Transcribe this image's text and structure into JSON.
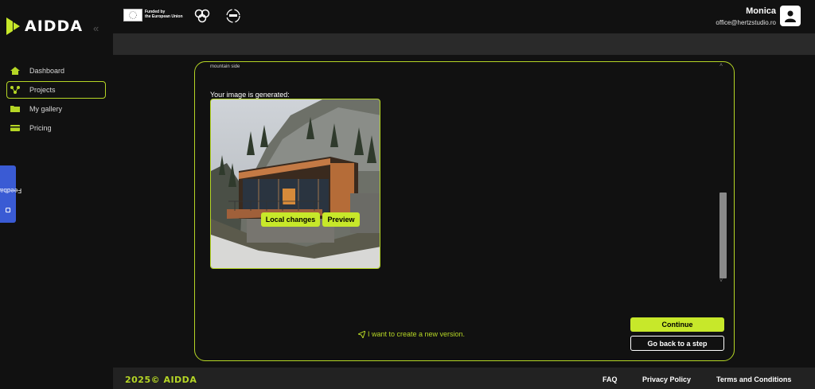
{
  "brand": {
    "name": "AIDDA",
    "accent": "#b5d625"
  },
  "sidebar": {
    "collapse_icon": "double-chevron-left-icon",
    "collapse_glyph": "«",
    "items": [
      {
        "label": "Dashboard",
        "icon": "home-icon",
        "active": false
      },
      {
        "label": "Projects",
        "icon": "projects-icon",
        "active": true
      },
      {
        "label": "My gallery",
        "icon": "folder-icon",
        "active": false
      },
      {
        "label": "Pricing",
        "icon": "card-icon",
        "active": false
      }
    ],
    "feedback_label": "Feedback"
  },
  "header": {
    "eu_line1": "Funded by",
    "eu_line2": "the European Union",
    "user_name": "Monica",
    "user_email": "office@hertzstudio.ro"
  },
  "panel": {
    "prompt_text": "mountain side",
    "generated_label": "Your image is generated:",
    "local_changes_label": "Local changes",
    "preview_label": "Preview",
    "new_version_label": "I want to create a new version.",
    "continue_label": "Continue",
    "back_label": "Go back to a step",
    "scroll_up_glyph": "˄",
    "scroll_down_glyph": "˅"
  },
  "footer": {
    "copyright": "2025© AIDDA",
    "links": [
      "FAQ",
      "Privacy Policy",
      "Terms and Conditions"
    ]
  }
}
